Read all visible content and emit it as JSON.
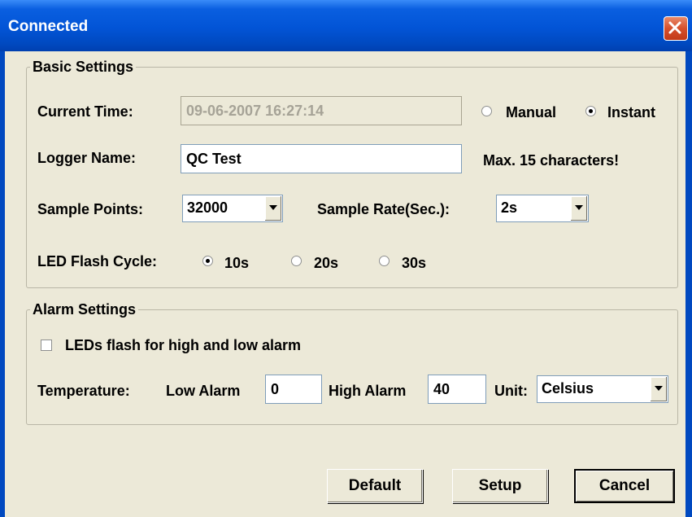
{
  "window": {
    "title": "Connected"
  },
  "basic": {
    "legend": "Basic Settings",
    "current_time_label": "Current Time:",
    "current_time_value": "09-06-2007 16:27:14",
    "time_mode_options": [
      "Manual",
      "Instant"
    ],
    "time_mode_selected": "Instant",
    "logger_name_label": "Logger Name:",
    "logger_name_value": "QC Test",
    "logger_name_hint": "Max. 15 characters!",
    "sample_points_label": "Sample Points:",
    "sample_points_value": "32000",
    "sample_rate_label": "Sample Rate(Sec.):",
    "sample_rate_value": "2s",
    "led_cycle_label": "LED Flash Cycle:",
    "led_cycle_options": [
      "10s",
      "20s",
      "30s"
    ],
    "led_cycle_selected": "10s"
  },
  "alarm": {
    "legend": "Alarm Settings",
    "led_flash_label": "LEDs flash for high and low alarm",
    "led_flash_checked": false,
    "temperature_label": "Temperature:",
    "low_alarm_label": "Low Alarm",
    "low_alarm_value": "0",
    "high_alarm_label": "High Alarm",
    "high_alarm_value": "40",
    "unit_label": "Unit:",
    "unit_value": "Celsius"
  },
  "buttons": {
    "default": "Default",
    "setup": "Setup",
    "cancel": "Cancel"
  }
}
